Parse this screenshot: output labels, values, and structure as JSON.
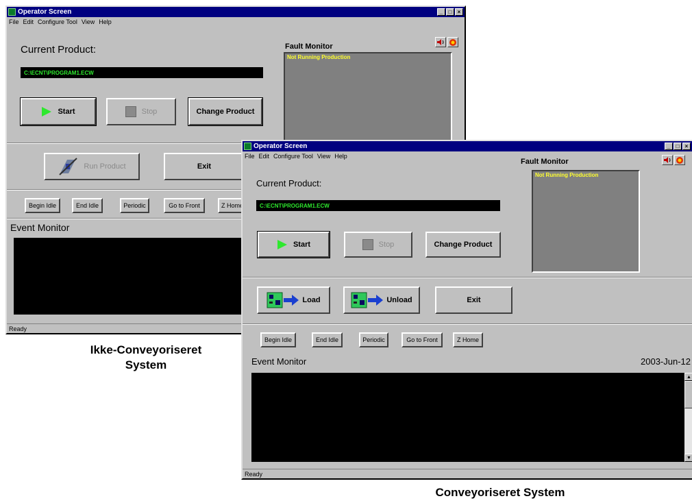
{
  "window_title": "Operator Screen",
  "menu": [
    "File",
    "Edit",
    "Configure Tool",
    "View",
    "Help"
  ],
  "title_buttons": [
    "_",
    "□",
    "×"
  ],
  "current_product_label": "Current Product:",
  "product_path": "C:\\ECNT\\PROGRAM1.ECW",
  "fault_monitor_label": "Fault Monitor",
  "fault_status": "Not Running Production",
  "start_label": "Start",
  "stop_label": "Stop",
  "change_product_label": "Change Product",
  "run_product_label": "Run Product",
  "load_label": "Load",
  "unload_label": "Unload",
  "exit_label": "Exit",
  "idle_buttons": [
    "Begin Idle",
    "End Idle",
    "Periodic",
    "Go to Front",
    "Z Home"
  ],
  "event_monitor_label": "Event Monitor",
  "event_date": "2003-Jun-12",
  "status_text": "Ready",
  "caption_non_conveyor": [
    "Ikke-Conveyoriseret",
    "System"
  ],
  "caption_conveyor": "Conveyoriseret System",
  "icons": [
    "app-icon",
    "speaker-icon",
    "alarm-icon",
    "play-icon",
    "stop-icon",
    "run-product-icon",
    "load-board-icon",
    "unload-board-icon",
    "scroll-up-icon",
    "scroll-down-icon"
  ],
  "colors": {
    "titlebar": "#000080",
    "window_bg": "#c0c0c0",
    "path_text": "#2ee82e",
    "fault_text": "#ffff2e",
    "fault_bg": "#808080",
    "play_icon": "#2ee82e"
  }
}
